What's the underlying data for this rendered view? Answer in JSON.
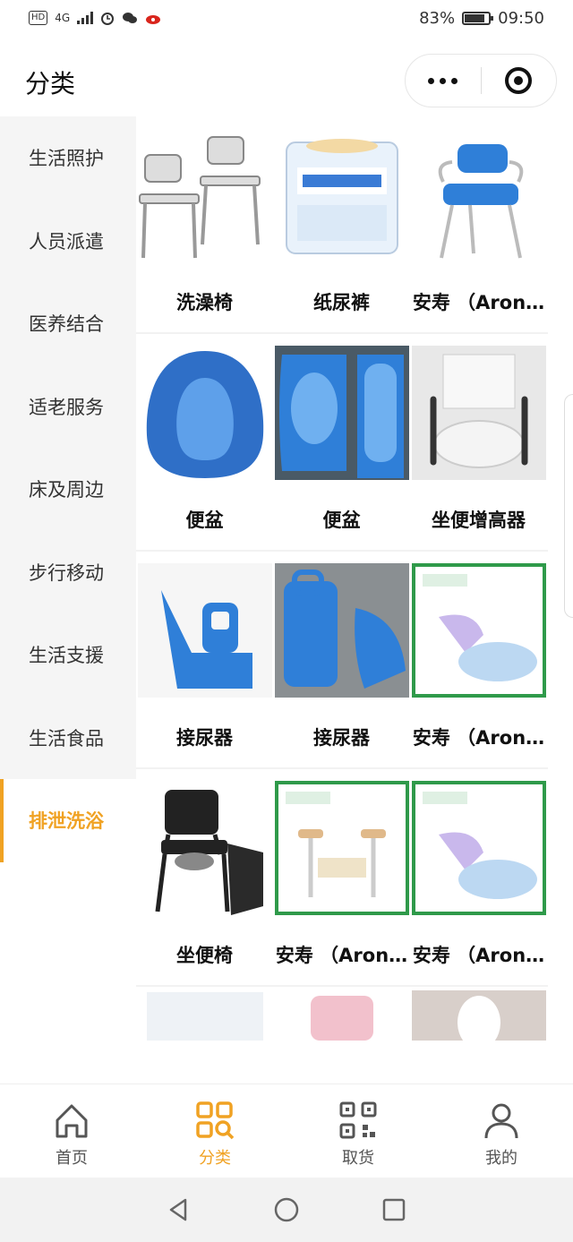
{
  "status_bar": {
    "left_icons": [
      "HD",
      "4G",
      "signal-icon",
      "alarm-icon",
      "wechat-icon",
      "sina-icon"
    ],
    "battery": "83%",
    "time": "09:50"
  },
  "header": {
    "title": "分类"
  },
  "sidebar": {
    "items": [
      {
        "label": "生活照护",
        "active": false
      },
      {
        "label": "人员派遣",
        "active": false
      },
      {
        "label": "医养结合",
        "active": false
      },
      {
        "label": "适老服务",
        "active": false
      },
      {
        "label": "床及周边",
        "active": false
      },
      {
        "label": "步行移动",
        "active": false
      },
      {
        "label": "生活支援",
        "active": false
      },
      {
        "label": "生活食品",
        "active": false
      },
      {
        "label": "排泄洗浴",
        "active": true
      }
    ]
  },
  "products": [
    [
      {
        "name": "洗澡椅",
        "icon": "bath-chair-image"
      },
      {
        "name": "纸尿裤",
        "icon": "diaper-package-image"
      },
      {
        "name": "安寿 （Aron…",
        "icon": "blue-shower-chair-image"
      }
    ],
    [
      {
        "name": "便盆",
        "icon": "bedpan-image"
      },
      {
        "name": "便盆",
        "icon": "bedpan-image"
      },
      {
        "name": "坐便增高器",
        "icon": "toilet-riser-image"
      }
    ],
    [
      {
        "name": "接尿器",
        "icon": "urinal-image"
      },
      {
        "name": "接尿器",
        "icon": "urinal-image"
      },
      {
        "name": "安寿 （Aron…",
        "icon": "urinal-image"
      }
    ],
    [
      {
        "name": "坐便椅",
        "icon": "commode-chair-image"
      },
      {
        "name": "安寿 （Aron…",
        "icon": "toilet-frame-image"
      },
      {
        "name": "安寿 （Aron…",
        "icon": "urinal-image"
      }
    ]
  ],
  "tabbar": {
    "items": [
      {
        "label": "首页",
        "icon": "home-icon",
        "active": false
      },
      {
        "label": "分类",
        "icon": "category-icon",
        "active": true
      },
      {
        "label": "取货",
        "icon": "qr-code-icon",
        "active": false
      },
      {
        "label": "我的",
        "icon": "user-icon",
        "active": false
      }
    ]
  },
  "colors": {
    "accent": "#f0a223",
    "sidebar_bg": "#f5f5f5",
    "product_blue": "#2f7fd8"
  }
}
